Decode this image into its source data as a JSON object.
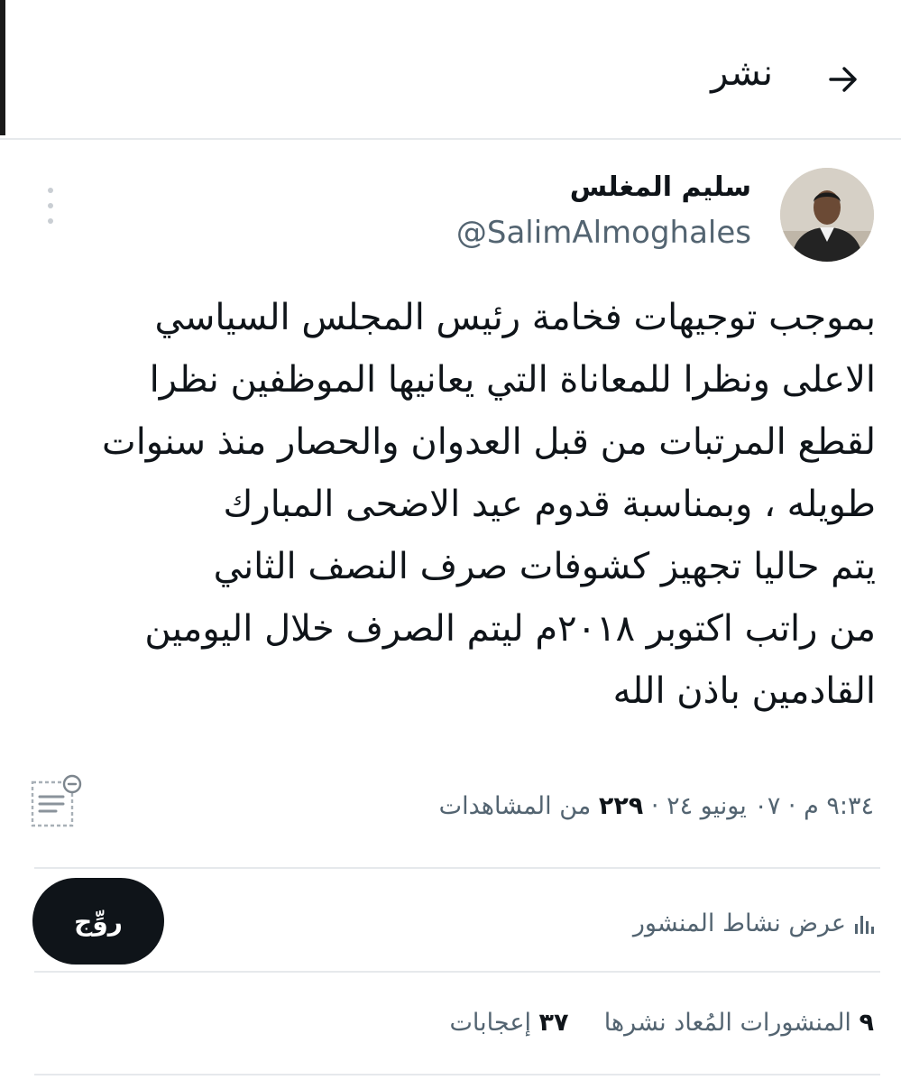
{
  "header": {
    "title": "نشر",
    "back_icon": "arrow-right-icon"
  },
  "author": {
    "name": "سليم المغلس",
    "handle": "@SalimAlmoghales"
  },
  "post": {
    "lines": [
      "بموجب توجيهات فخامة رئيس المجلس السياسي",
      "الاعلى ونظرا للمعاناة التي يعانيها الموظفين نظرا",
      "لقطع المرتبات من قبل العدوان والحصار منذ سنوات",
      "طويله ، وبمناسبة قدوم عيد الاضحى المبارك",
      "يتم حاليا تجهيز كشوفات صرف النصف الثاني",
      "من راتب اكتوبر ٢٠١٨م ليتم الصرف خلال اليومين",
      "القادمين باذن الله"
    ]
  },
  "meta": {
    "time_date": "٩:٣٤ م · ٠٧ يونيو ٢٤ ·",
    "views_count": "٢٢٩",
    "views_label": "من المشاهدات"
  },
  "activity": {
    "label": "عرض نشاط المنشور",
    "icon": "bar-chart-icon"
  },
  "rate_button": {
    "label": "روِّج"
  },
  "stats": {
    "reposts_count": "٩",
    "reposts_label": "المنشورات المُعاد نشرها",
    "likes_count": "٣٧",
    "likes_label": "إعجابات"
  },
  "colors": {
    "text": "#0f1419",
    "secondary": "#536471",
    "divider": "#e6e9ec",
    "button": "#0f1419"
  }
}
